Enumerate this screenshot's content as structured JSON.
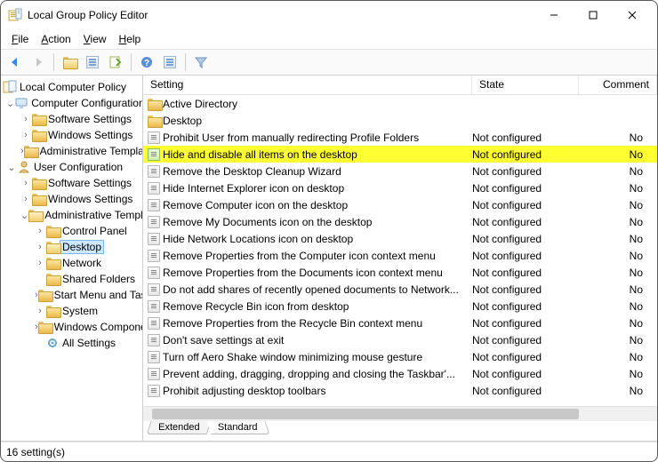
{
  "window": {
    "title": "Local Group Policy Editor"
  },
  "menu": {
    "file": "File",
    "action": "Action",
    "view": "View",
    "help": "Help"
  },
  "tree": {
    "root": "Local Computer Policy",
    "computer_config": "Computer Configuration",
    "cc_software": "Software Settings",
    "cc_windows": "Windows Settings",
    "cc_admin": "Administrative Templates",
    "user_config": "User Configuration",
    "uc_software": "Software Settings",
    "uc_windows": "Windows Settings",
    "uc_admin": "Administrative Templates",
    "control_panel": "Control Panel",
    "desktop": "Desktop",
    "network": "Network",
    "shared": "Shared Folders",
    "startmenu": "Start Menu and Taskbar",
    "system": "System",
    "wincomp": "Windows Components",
    "allsettings": "All Settings"
  },
  "columns": {
    "setting": "Setting",
    "state": "State",
    "comment": "Comment"
  },
  "rows": [
    {
      "type": "folder",
      "setting": "Active Directory",
      "state": "",
      "comment": ""
    },
    {
      "type": "folder",
      "setting": "Desktop",
      "state": "",
      "comment": ""
    },
    {
      "type": "policy",
      "setting": "Prohibit User from manually redirecting Profile Folders",
      "state": "Not configured",
      "comment": "No"
    },
    {
      "type": "policy",
      "setting": "Hide and disable all items on the desktop",
      "state": "Not configured",
      "comment": "No",
      "highlight": true
    },
    {
      "type": "policy",
      "setting": "Remove the Desktop Cleanup Wizard",
      "state": "Not configured",
      "comment": "No"
    },
    {
      "type": "policy",
      "setting": "Hide Internet Explorer icon on desktop",
      "state": "Not configured",
      "comment": "No"
    },
    {
      "type": "policy",
      "setting": "Remove Computer icon on the desktop",
      "state": "Not configured",
      "comment": "No"
    },
    {
      "type": "policy",
      "setting": "Remove My Documents icon on the desktop",
      "state": "Not configured",
      "comment": "No"
    },
    {
      "type": "policy",
      "setting": "Hide Network Locations icon on desktop",
      "state": "Not configured",
      "comment": "No"
    },
    {
      "type": "policy",
      "setting": "Remove Properties from the Computer icon context menu",
      "state": "Not configured",
      "comment": "No"
    },
    {
      "type": "policy",
      "setting": "Remove Properties from the Documents icon context menu",
      "state": "Not configured",
      "comment": "No"
    },
    {
      "type": "policy",
      "setting": "Do not add shares of recently opened documents to Network...",
      "state": "Not configured",
      "comment": "No"
    },
    {
      "type": "policy",
      "setting": "Remove Recycle Bin icon from desktop",
      "state": "Not configured",
      "comment": "No"
    },
    {
      "type": "policy",
      "setting": "Remove Properties from the Recycle Bin context menu",
      "state": "Not configured",
      "comment": "No"
    },
    {
      "type": "policy",
      "setting": "Don't save settings at exit",
      "state": "Not configured",
      "comment": "No"
    },
    {
      "type": "policy",
      "setting": "Turn off Aero Shake window minimizing mouse gesture",
      "state": "Not configured",
      "comment": "No"
    },
    {
      "type": "policy",
      "setting": "Prevent adding, dragging, dropping and closing the Taskbar'...",
      "state": "Not configured",
      "comment": "No"
    },
    {
      "type": "policy",
      "setting": "Prohibit adjusting desktop toolbars",
      "state": "Not configured",
      "comment": "No"
    }
  ],
  "tabs": {
    "extended": "Extended",
    "standard": "Standard"
  },
  "status": "16 setting(s)"
}
